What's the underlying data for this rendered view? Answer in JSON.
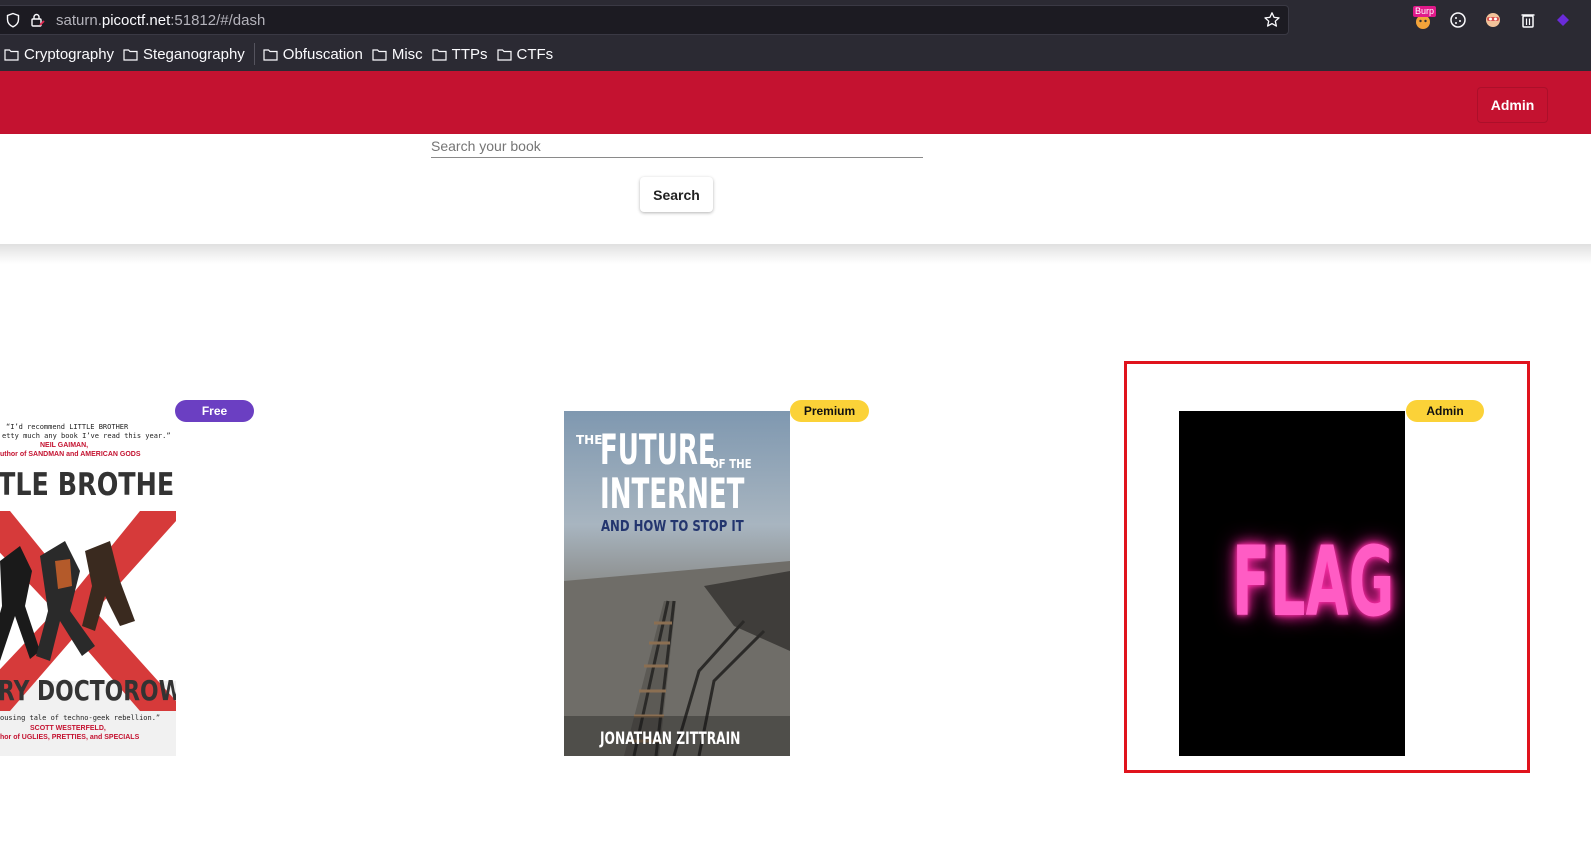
{
  "browser": {
    "url_prefix": "saturn.",
    "url_host": "picoctf.net",
    "url_suffix": ":51812/#/dash",
    "extension_badge": "Burp",
    "bookmarks": [
      {
        "label": "Cryptography"
      },
      {
        "label": "Steganography"
      },
      {
        "label": "Obfuscation"
      },
      {
        "label": "Misc"
      },
      {
        "label": "TTPs"
      },
      {
        "label": "CTFs"
      }
    ]
  },
  "header": {
    "admin_label": "Admin"
  },
  "search": {
    "placeholder": "Search your book",
    "button_label": "Search"
  },
  "books": [
    {
      "badge": "Free",
      "cover": {
        "quote_top_1": "“I’d recommend LITTLE BROTHER",
        "quote_top_2": "etty much any book I’ve read this year.”",
        "quote_top_author": "NEIL GAIMAN,",
        "quote_top_author_sub": "uthor of SANDMAN and AMERICAN GODS",
        "title": "TLE BROTHER",
        "author": "RY DOCTOROW",
        "quote_bottom_1": "ousing tale of techno-geek rebellion.”",
        "quote_bottom_author": "SCOTT WESTERFELD,",
        "quote_bottom_author_sub": "hor of UGLIES, PRETTIES, and SPECIALS"
      }
    },
    {
      "badge": "Premium",
      "cover": {
        "the": "THE",
        "title_1": "FUTURE",
        "of_the": "OF THE",
        "title_2": "INTERNET",
        "subtitle": "AND HOW TO STOP IT",
        "author": "JONATHAN ZITTRAIN"
      }
    },
    {
      "badge": "Admin",
      "cover": {
        "title": "FLAG"
      }
    }
  ],
  "colors": {
    "header_red": "#c41230",
    "free_badge": "#6b3fc2",
    "premium_badge": "#fbd238",
    "highlight": "#e0131d",
    "flag_neon": "#ff4fb8"
  }
}
